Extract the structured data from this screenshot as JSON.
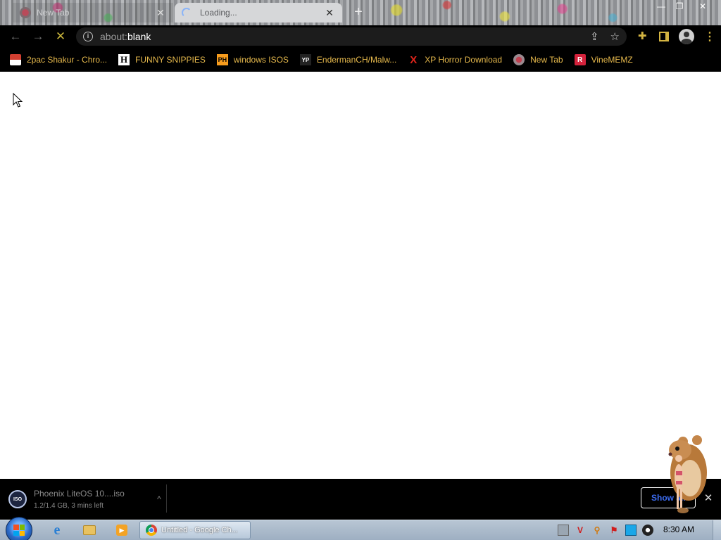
{
  "browser": {
    "tabs": [
      {
        "title": "New Tab",
        "state": "inactive"
      },
      {
        "title": "Loading...",
        "state": "active-loading"
      }
    ],
    "new_tab_symbol": "+",
    "window_controls": {
      "minimize": "—",
      "restore": "❐",
      "close": "✕"
    },
    "toolbar": {
      "back_icon": "←",
      "forward_icon": "→",
      "stop_icon": "✕",
      "url_scheme": "about:",
      "url_path": "blank",
      "share_icon": "⇪",
      "bookmark_star_icon": "☆",
      "extensions_icon": "✚",
      "menu_icon": "⋮"
    },
    "bookmarks": [
      {
        "label": "2pac Shakur - Chro...",
        "icon": "chrome-web-store-icon"
      },
      {
        "label": "FUNNY SNIPPIES",
        "icon": "h-icon",
        "glyph": "H"
      },
      {
        "label": "windows ISOS",
        "icon": "ph-icon",
        "glyph": "PH"
      },
      {
        "label": "EndermanCH/Malw...",
        "icon": "yp-icon",
        "glyph": "YP"
      },
      {
        "label": "XP Horror Download",
        "icon": "x-icon",
        "glyph": "X"
      },
      {
        "label": "New Tab",
        "icon": "tab-favicon-icon"
      },
      {
        "label": "VineMEMZ",
        "icon": "r-icon",
        "glyph": "R"
      }
    ]
  },
  "download_shelf": {
    "file_name": "Phoenix LiteOS 10....iso",
    "status": "1.2/1.4 GB, 3 mins left",
    "icon_glyph": "ISO",
    "chevron": "^",
    "show_all_label": "Show all",
    "close_icon": "✕"
  },
  "taskbar": {
    "start_label": "Start",
    "task_button_label": "Untitled - Google Ch...",
    "clock": "8:30 AM",
    "tray_icons": [
      "network-icon",
      "v-icon",
      "search-icon",
      "flag-icon",
      "display-icon",
      "volume-icon"
    ]
  },
  "colors": {
    "bookmark_text": "#e6b94c",
    "chrome_accent": "#d3b442",
    "show_all_text": "#3c6cf0",
    "toolbar_bg": "#000000"
  }
}
